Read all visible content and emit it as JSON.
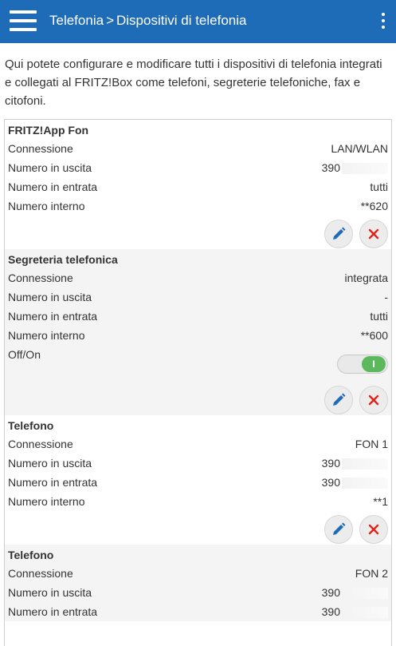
{
  "header": {
    "crumb_parent": "Telefonia",
    "separator": ">",
    "crumb_current": "Dispositivi di telefonia",
    "menu_icon": "hamburger-icon",
    "more_icon": "kebab-icon"
  },
  "intro": "Qui potete configurare e modificare tutti i dispositivi di telefonia integrati e collegati al FRITZ!Box come telefoni, segreterie telefoniche, fax e citofoni.",
  "devices": [
    {
      "title": "FRITZ!App Fon",
      "rows": [
        {
          "label": "Connessione",
          "value": "LAN/WLAN"
        },
        {
          "label": "Numero in uscita",
          "value": "390"
        },
        {
          "label": "Numero in entrata",
          "value": "tutti"
        },
        {
          "label": "Numero interno",
          "value": "**620"
        }
      ]
    },
    {
      "title": "Segreteria telefonica",
      "rows": [
        {
          "label": "Connessione",
          "value": "integrata"
        },
        {
          "label": "Numero in uscita",
          "value": "-"
        },
        {
          "label": "Numero in entrata",
          "value": "tutti"
        },
        {
          "label": "Numero interno",
          "value": "**600"
        }
      ],
      "toggle": {
        "label": "Off/On",
        "state": "I"
      }
    },
    {
      "title": "Telefono",
      "rows": [
        {
          "label": "Connessione",
          "value": "FON 1"
        },
        {
          "label": "Numero in uscita",
          "value": "390"
        },
        {
          "label": "Numero in entrata",
          "value": "390"
        },
        {
          "label": "Numero interno",
          "value": "**1"
        }
      ]
    },
    {
      "title": "Telefono",
      "rows": [
        {
          "label": "Connessione",
          "value": "FON 2"
        },
        {
          "label": "Numero in uscita",
          "value": "390"
        },
        {
          "label": "Numero in entrata",
          "value": "390"
        }
      ]
    }
  ],
  "colors": {
    "header_bg": "#1e6cb8",
    "edit_icon": "#1e6cb8",
    "delete_icon": "#e2231a",
    "toggle_on": "#5cb85c"
  },
  "icons": {
    "edit": "pencil-icon",
    "delete": "close-icon"
  }
}
